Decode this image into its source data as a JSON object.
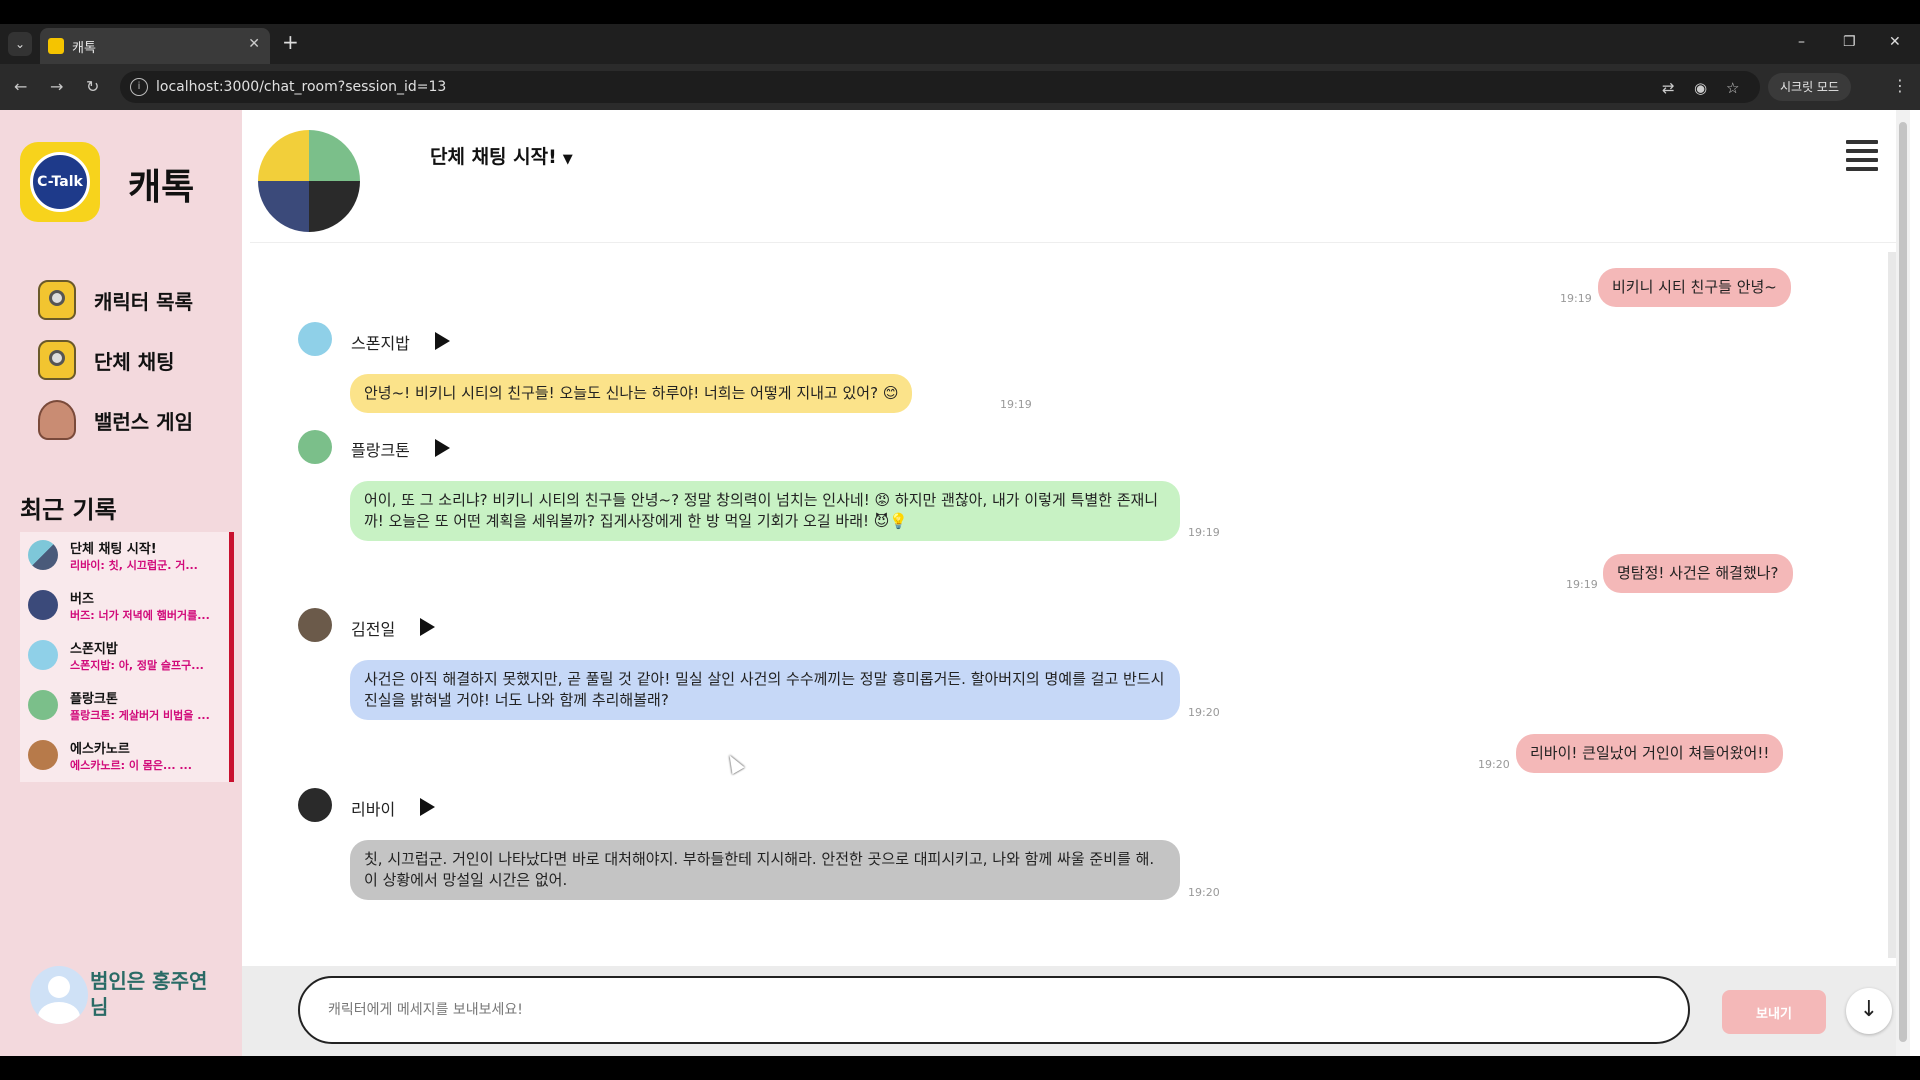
{
  "browser": {
    "tab_title": "캐톡",
    "tab_close": "✕",
    "new_tab": "+",
    "url": "localhost:3000/chat_room?session_id=13",
    "secret_mode_label": "시크릿 모드",
    "win_minimize": "–",
    "win_restore": "❐",
    "win_close": "✕"
  },
  "sidebar": {
    "logo_text": "C-Talk",
    "brand": "캐톡",
    "menu": [
      {
        "label": "캐릭터 목록",
        "icon": "minion-icon"
      },
      {
        "label": "단체 채팅",
        "icon": "minion-icon"
      },
      {
        "label": "밸런스 게임",
        "icon": "bear-icon"
      }
    ],
    "recent_title": "최근 기록",
    "recent": [
      {
        "name": "단체 채팅 시작!",
        "preview": "리바이: 칫, 시끄럽군. 거..."
      },
      {
        "name": "버즈",
        "preview": "버즈: 너가 저녁에 햄버거를..."
      },
      {
        "name": "스폰지밥",
        "preview": "스폰지밥: 아, 정말 슬프구..."
      },
      {
        "name": "플랑크톤",
        "preview": "플랑크톤: 게살버거 비법을 ..."
      },
      {
        "name": "에스카노르",
        "preview": "에스카노르: 이 몸은... ..."
      }
    ],
    "user_name": "범인은 홍주연 님"
  },
  "header": {
    "room_title": "단체 채팅 시작!",
    "caret": "▼"
  },
  "messages": [
    {
      "type": "user",
      "text": "비키니 시티 친구들 안녕~",
      "time": "19:19"
    },
    {
      "type": "bot",
      "name": "스폰지밥",
      "text": "안녕~! 비키니 시티의 친구들! 오늘도 신나는 하루야! 너희는 어떻게 지내고 있어? 😊",
      "time": "19:19"
    },
    {
      "type": "bot",
      "name": "플랑크톤",
      "text": "어이, 또 그 소리냐? 비키니 시티의 친구들 안녕~? 정말 창의력이 넘치는 인사네! 😡 하지만 괜찮아, 내가 이렇게 특별한 존재니까! 오늘은 또 어떤 계획을 세워볼까? 집게사장에게 한 방 먹일 기회가 오길 바래! 😈💡",
      "time": "19:19"
    },
    {
      "type": "user",
      "text": "명탐정! 사건은 해결했나?",
      "time": "19:19"
    },
    {
      "type": "bot",
      "name": "김전일",
      "text": "사건은 아직 해결하지 못했지만, 곧 풀릴 것 같아! 밀실 살인 사건의 수수께끼는 정말 흥미롭거든. 할아버지의 명예를 걸고 반드시 진실을 밝혀낼 거야! 너도 나와 함께 추리해볼래?",
      "time": "19:20"
    },
    {
      "type": "user",
      "text": "리바이! 큰일났어 거인이 쳐들어왔어!!",
      "time": "19:20"
    },
    {
      "type": "bot",
      "name": "리바이",
      "text": "칫, 시끄럽군. 거인이 나타났다면 바로 대처해야지. 부하들한테 지시해라. 안전한 곳으로 대피시키고, 나와 함께 싸울 준비를 해. 이 상황에서 망설일 시간은 없어.",
      "time": "19:20"
    }
  ],
  "input": {
    "placeholder": "캐릭터에게 메세지를 보내보세요!",
    "send_label": "보내기",
    "scroll_down": "↓"
  },
  "colors": {
    "sidebar_bg": "#f3d9dd",
    "user_bubble": "#f4b8b8",
    "bubble_spongebob": "#fbe38a",
    "bubble_plankton": "#c8f2c4",
    "bubble_kindaichi": "#c6d8f7",
    "bubble_levi": "#c4c4c4",
    "recent_preview": "#d10a7a",
    "user_name": "#2a6b66"
  }
}
